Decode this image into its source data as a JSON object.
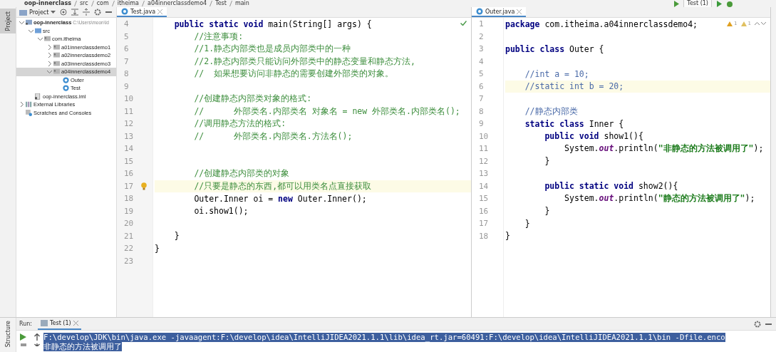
{
  "breadcrumb": [
    "oop-innerclass",
    "src",
    "com",
    "itheima",
    "a04innerclassdemo4",
    "Test",
    "main"
  ],
  "toolbar": {
    "run_config": "Test (1)"
  },
  "left_stripe": {
    "label": "Project"
  },
  "project_panel": {
    "title": "Project",
    "tree": [
      {
        "label": "oop-innerclass",
        "hint": "C:\\Users\\moon\\Id",
        "kind": "module",
        "expanded": true,
        "selected": false,
        "children": [
          {
            "label": "src",
            "kind": "folder",
            "expanded": true,
            "selected": false,
            "children": [
              {
                "label": "com.itheima",
                "kind": "package",
                "expanded": true,
                "selected": false,
                "children": [
                  {
                    "label": "a01innerclassdemo1",
                    "kind": "package",
                    "expanded": false,
                    "selected": false
                  },
                  {
                    "label": "a02innerclassdemo2",
                    "kind": "package",
                    "expanded": false,
                    "selected": false
                  },
                  {
                    "label": "a03innerclassdemo3",
                    "kind": "package",
                    "expanded": false,
                    "selected": false
                  },
                  {
                    "label": "a04innerclassdemo4",
                    "kind": "package",
                    "expanded": true,
                    "selected": true,
                    "children": [
                      {
                        "label": "Outer",
                        "kind": "class",
                        "selected": false
                      },
                      {
                        "label": "Test",
                        "kind": "class",
                        "selected": false
                      }
                    ]
                  }
                ]
              }
            ]
          },
          {
            "label": "oop-innerclass.iml",
            "kind": "iml",
            "selected": false
          }
        ]
      },
      {
        "label": "External Libraries",
        "kind": "library",
        "expanded": false,
        "selected": false
      },
      {
        "label": "Scratches and Consoles",
        "kind": "scratches",
        "selected": false
      }
    ]
  },
  "editors": [
    {
      "tab": "Test.java",
      "checkmark": true,
      "lines": [
        {
          "n": "4",
          "highlighted": false,
          "tokens": [
            {
              "t": "    public static void",
              "kind": "keyword"
            },
            {
              "t": " main(String[] args) {",
              "kind": "plain"
            }
          ]
        },
        {
          "n": "5",
          "highlighted": false,
          "tokens": [
            {
              "t": "        //注意事项:",
              "kind": "comment"
            }
          ]
        },
        {
          "n": "6",
          "highlighted": false,
          "tokens": [
            {
              "t": "        //1.静态内部类也是成员内部类中的一种",
              "kind": "comment"
            }
          ]
        },
        {
          "n": "7",
          "highlighted": false,
          "tokens": [
            {
              "t": "        //2.静态内部类只能访问外部类中的静态变量和静态方法,",
              "kind": "comment"
            }
          ]
        },
        {
          "n": "8",
          "highlighted": false,
          "tokens": [
            {
              "t": "        //  如果想要访问非静态的需要创建外部类的对象。",
              "kind": "comment"
            }
          ]
        },
        {
          "n": "9",
          "highlighted": false
        },
        {
          "n": "10",
          "highlighted": false,
          "tokens": [
            {
              "t": "        //创建静态内部类对象的格式:",
              "kind": "comment"
            }
          ]
        },
        {
          "n": "11",
          "highlighted": false,
          "tokens": [
            {
              "t": "        //      外部类名.内部类名 对象名 = new 外部类名.内部类名();",
              "kind": "comment"
            }
          ]
        },
        {
          "n": "12",
          "highlighted": false,
          "tokens": [
            {
              "t": "        //调用静态方法的格式:",
              "kind": "comment"
            }
          ]
        },
        {
          "n": "13",
          "highlighted": false,
          "tokens": [
            {
              "t": "        //      外部类名.内部类名.方法名();",
              "kind": "comment"
            }
          ]
        },
        {
          "n": "14",
          "highlighted": false
        },
        {
          "n": "15",
          "highlighted": false
        },
        {
          "n": "16",
          "highlighted": false,
          "tokens": [
            {
              "t": "        //创建静态内部类的对象",
              "kind": "comment"
            }
          ]
        },
        {
          "n": "17",
          "highlighted": true,
          "bulb": true,
          "tokens": [
            {
              "t": "        //只要是静态的东西,都可以用类名点直接获取",
              "kind": "comment"
            }
          ]
        },
        {
          "n": "18",
          "highlighted": false,
          "tokens": [
            {
              "t": "        Outer.Inner oi = ",
              "kind": "plain"
            },
            {
              "t": "new",
              "kind": "keyword"
            },
            {
              "t": " Outer.Inner();",
              "kind": "plain"
            }
          ]
        },
        {
          "n": "19",
          "highlighted": false,
          "tokens": [
            {
              "t": "        oi.show1();",
              "kind": "plain"
            }
          ]
        },
        {
          "n": "20",
          "highlighted": false
        },
        {
          "n": "21",
          "highlighted": false,
          "tokens": [
            {
              "t": "    }",
              "kind": "plain"
            }
          ]
        },
        {
          "n": "22",
          "highlighted": false,
          "tokens": [
            {
              "t": "}",
              "kind": "plain"
            }
          ]
        },
        {
          "n": "23",
          "highlighted": false
        }
      ]
    },
    {
      "tab": "Outer.java",
      "warnings": [
        "1",
        "1"
      ],
      "lines": [
        {
          "n": "1",
          "highlighted": false,
          "tokens": [
            {
              "t": "package",
              "kind": "keyword"
            },
            {
              "t": " com.itheima.a04innerclassdemo4;",
              "kind": "plain"
            }
          ]
        },
        {
          "n": "2",
          "highlighted": false
        },
        {
          "n": "3",
          "highlighted": false,
          "tokens": [
            {
              "t": "public class",
              "kind": "keyword"
            },
            {
              "t": " Outer {",
              "kind": "plain"
            }
          ]
        },
        {
          "n": "4",
          "highlighted": false
        },
        {
          "n": "5",
          "highlighted": false,
          "tokens": [
            {
              "t": "    //int a = 10;",
              "kind": "comment-alt"
            }
          ]
        },
        {
          "n": "6",
          "highlighted": true,
          "tokens": [
            {
              "t": "    //static int b = 20;",
              "kind": "comment-alt"
            }
          ]
        },
        {
          "n": "7",
          "highlighted": false
        },
        {
          "n": "8",
          "highlighted": false,
          "tokens": [
            {
              "t": "    //静态内部类",
              "kind": "comment-alt"
            }
          ]
        },
        {
          "n": "9",
          "highlighted": false,
          "tokens": [
            {
              "t": "    static class",
              "kind": "keyword"
            },
            {
              "t": " Inner {",
              "kind": "plain"
            }
          ]
        },
        {
          "n": "10",
          "highlighted": false,
          "tokens": [
            {
              "t": "        public void",
              "kind": "keyword"
            },
            {
              "t": " show1(){",
              "kind": "plain"
            }
          ]
        },
        {
          "n": "11",
          "highlighted": false,
          "tokens": [
            {
              "t": "            System.",
              "kind": "plain"
            },
            {
              "t": "out",
              "kind": "field"
            },
            {
              "t": ".println(",
              "kind": "plain"
            },
            {
              "t": "\"非静态的方法被调用了\"",
              "kind": "string"
            },
            {
              "t": ");",
              "kind": "plain"
            }
          ]
        },
        {
          "n": "12",
          "highlighted": false,
          "tokens": [
            {
              "t": "        }",
              "kind": "plain"
            }
          ]
        },
        {
          "n": "13",
          "highlighted": false
        },
        {
          "n": "14",
          "highlighted": false,
          "tokens": [
            {
              "t": "        public static void",
              "kind": "keyword"
            },
            {
              "t": " show2(){",
              "kind": "plain"
            }
          ]
        },
        {
          "n": "15",
          "highlighted": false,
          "tokens": [
            {
              "t": "            System.",
              "kind": "plain"
            },
            {
              "t": "out",
              "kind": "field"
            },
            {
              "t": ".println(",
              "kind": "plain"
            },
            {
              "t": "\"静态的方法被调用了\"",
              "kind": "string"
            },
            {
              "t": ");",
              "kind": "plain"
            }
          ]
        },
        {
          "n": "16",
          "highlighted": false,
          "tokens": [
            {
              "t": "        }",
              "kind": "plain"
            }
          ]
        },
        {
          "n": "17",
          "highlighted": false,
          "tokens": [
            {
              "t": "    }",
              "kind": "plain"
            }
          ]
        },
        {
          "n": "18",
          "highlighted": false,
          "tokens": [
            {
              "t": "}",
              "kind": "plain"
            }
          ]
        }
      ]
    }
  ],
  "bottom_stripe": {
    "label": "Structure"
  },
  "run_panel": {
    "title": "Run:",
    "tab": "Test (1)",
    "console": [
      {
        "text": "F:\\develop\\JDK\\bin\\java.exe -javaagent:F:\\develop\\idea\\IntelliJIDEA2021.1.1\\lib\\idea_rt.jar=60491:F:\\develop\\idea\\IntelliJIDEA2021.1.1\\bin -Dfile.enco",
        "selected": true
      },
      {
        "text": "非静态的方法被调用了",
        "selected": true
      }
    ]
  }
}
